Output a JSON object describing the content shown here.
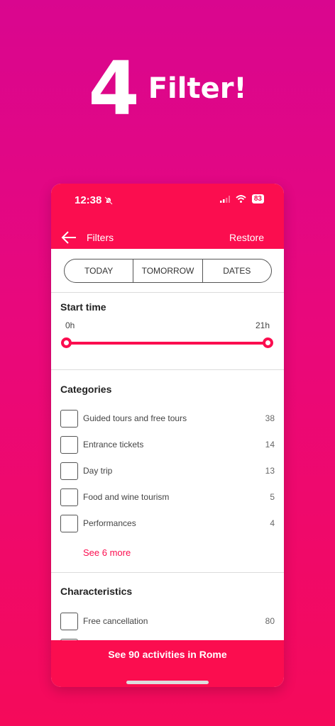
{
  "headline": {
    "number": "4",
    "word": "Filter!"
  },
  "status": {
    "time": "12:38",
    "battery": "83"
  },
  "nav": {
    "title": "Filters",
    "restore": "Restore"
  },
  "date_tabs": [
    "TODAY",
    "TOMORROW",
    "DATES"
  ],
  "start_time": {
    "title": "Start time",
    "min_label": "0h",
    "max_label": "21h",
    "range_start": 0,
    "range_end": 21
  },
  "categories": {
    "title": "Categories",
    "items": [
      {
        "label": "Guided tours and free tours",
        "count": "38"
      },
      {
        "label": "Entrance tickets",
        "count": "14"
      },
      {
        "label": "Day trip",
        "count": "13"
      },
      {
        "label": "Food and wine tourism",
        "count": "5"
      },
      {
        "label": "Performances",
        "count": "4"
      }
    ],
    "see_more": "See 6 more"
  },
  "characteristics": {
    "title": "Characteristics",
    "items": [
      {
        "label": "Free cancellation",
        "count": "80"
      }
    ]
  },
  "cta": {
    "label": "See 90 activities in Rome"
  },
  "colors": {
    "accent": "#fb0d4f",
    "gradient_top": "#d9068f",
    "gradient_bottom": "#f50a5a"
  }
}
